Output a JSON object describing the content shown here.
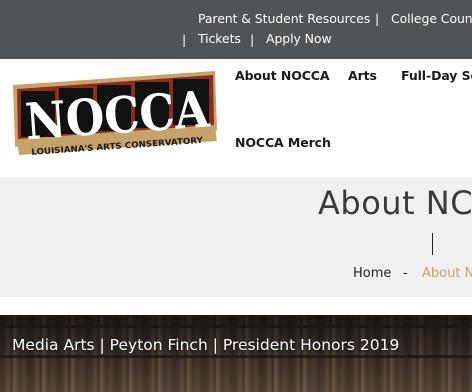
{
  "top_bar": {
    "links_row1": [
      "Parent & Student Resources",
      "College Couns"
    ],
    "links_row2": [
      "Tickets",
      "Apply Now"
    ]
  },
  "logo": {
    "wordmark": "NOCCA",
    "tagline": "LOUISIANA'S ARTS CONSERVATORY"
  },
  "nav": {
    "items": [
      "About NOCCA",
      "Arts",
      "Full-Day Sc",
      "NOCCA Merch"
    ]
  },
  "page": {
    "title": "About NC"
  },
  "breadcrumb": {
    "home": "Home",
    "separator": "-",
    "current": "About N"
  },
  "video": {
    "title": "Media Arts | Peyton Finch | President Honors 2019"
  },
  "colors": {
    "top_bar": "#505457",
    "accent_gold": "#c8a26b",
    "logo_red": "#8b2e1f",
    "hero_band": "#f0f0f0"
  }
}
